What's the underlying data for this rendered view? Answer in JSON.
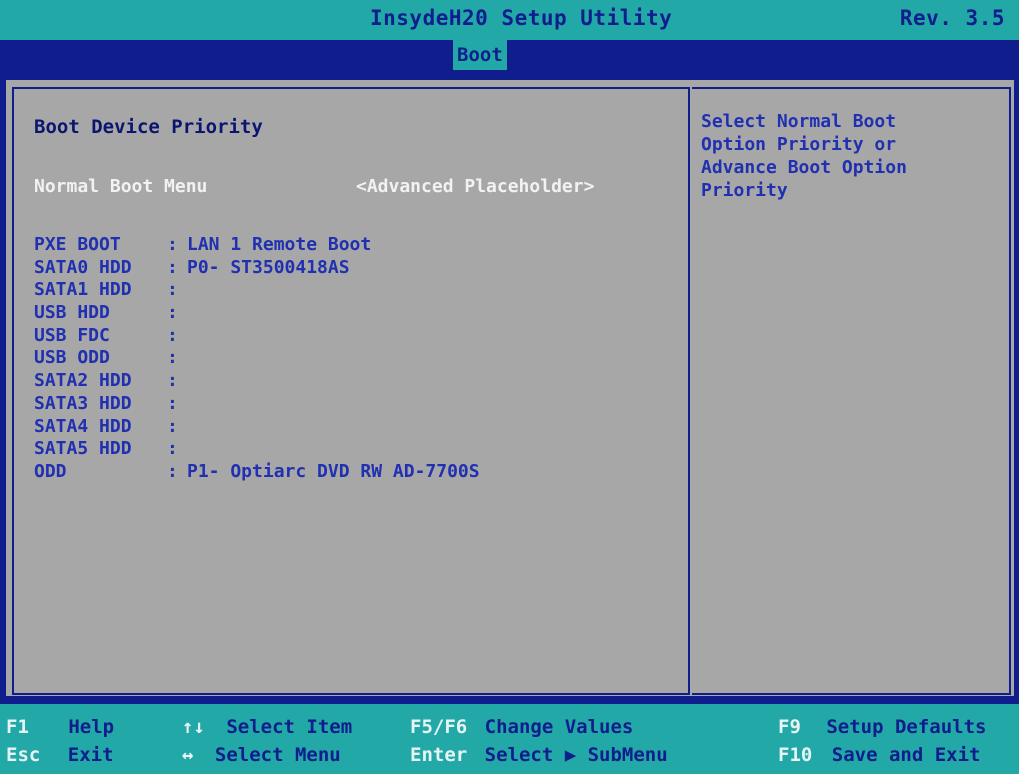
{
  "header": {
    "title": "InsydeH20 Setup Utility",
    "revision": "Rev. 3.5"
  },
  "tabs": [
    {
      "label": "Boot",
      "selected": true
    }
  ],
  "main": {
    "section_title": "Boot Device Priority",
    "normal_boot_menu": {
      "label": "Normal Boot Menu",
      "value": "<Advanced Placeholder>"
    },
    "boot_devices": [
      {
        "label": "PXE BOOT",
        "colon": ":",
        "value": "LAN 1 Remote Boot"
      },
      {
        "label": "SATA0 HDD",
        "colon": ":",
        "value": "P0- ST3500418AS"
      },
      {
        "label": "SATA1 HDD",
        "colon": ":",
        "value": ""
      },
      {
        "label": "USB HDD",
        "colon": ":",
        "value": ""
      },
      {
        "label": "USB FDC",
        "colon": ":",
        "value": ""
      },
      {
        "label": "USB ODD",
        "colon": ":",
        "value": ""
      },
      {
        "label": "SATA2 HDD",
        "colon": ":",
        "value": ""
      },
      {
        "label": "SATA3 HDD",
        "colon": ":",
        "value": ""
      },
      {
        "label": "SATA4 HDD",
        "colon": ":",
        "value": ""
      },
      {
        "label": "SATA5 HDD",
        "colon": ":",
        "value": ""
      },
      {
        "label": "ODD",
        "colon": ":",
        "value": "P1- Optiarc DVD RW AD-7700S"
      }
    ]
  },
  "help": {
    "lines": [
      "Select Normal Boot",
      "Option Priority or",
      "Advance Boot Option",
      "Priority"
    ]
  },
  "footer": {
    "keys": [
      {
        "key": "F1",
        "action": "Help"
      },
      {
        "key": "↑↓",
        "action": "Select Item"
      },
      {
        "key": "F5/F6",
        "action": "Change Values"
      },
      {
        "key": "F9",
        "action": "Setup Defaults"
      },
      {
        "key": "Esc",
        "action": "Exit"
      },
      {
        "key": "↔",
        "action": "Select Menu"
      },
      {
        "key": "Enter",
        "action": "Select ▶ SubMenu"
      },
      {
        "key": "F10",
        "action": "Save and Exit"
      }
    ]
  },
  "colors": {
    "background": "#0f1e8c",
    "accent": "#23a8a8",
    "panel": "#a7a7a7",
    "text_blue": "#2030b0",
    "text_white": "#f2f2f2"
  }
}
